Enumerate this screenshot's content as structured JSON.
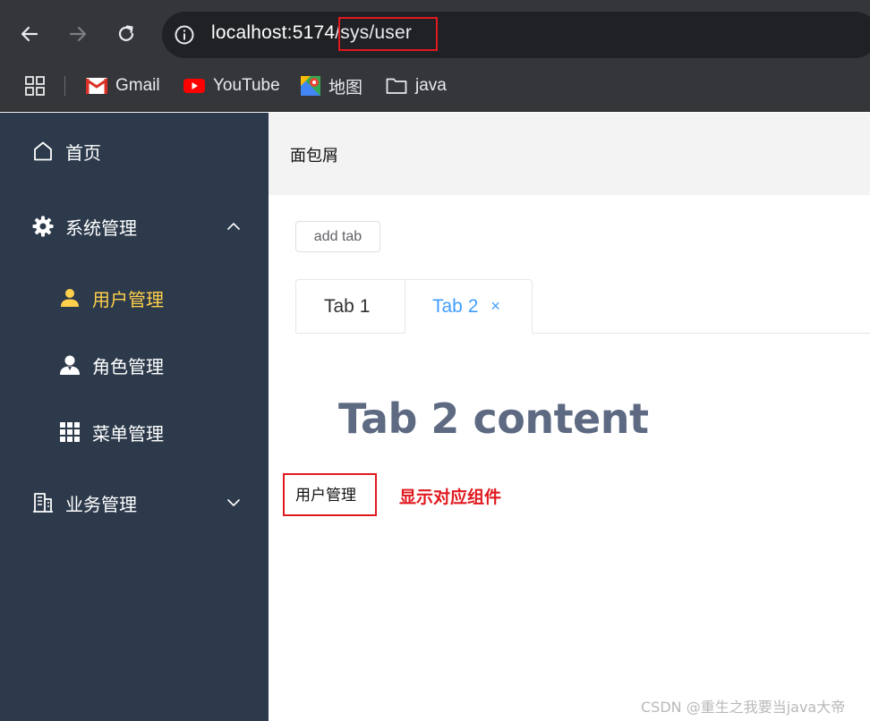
{
  "browser": {
    "url_host": "localhost:5174",
    "url_path": "/sys/user",
    "bookmarks": [
      "Gmail",
      "YouTube",
      "地图",
      "java"
    ]
  },
  "sidebar": {
    "items": [
      {
        "label": "首页",
        "icon": "home-icon"
      },
      {
        "label": "系统管理",
        "icon": "gear-icon",
        "expanded": true
      },
      {
        "label": "用户管理",
        "icon": "user-icon",
        "active": true
      },
      {
        "label": "角色管理",
        "icon": "person-icon"
      },
      {
        "label": "菜单管理",
        "icon": "grid-icon"
      },
      {
        "label": "业务管理",
        "icon": "building-icon",
        "expanded": false
      }
    ],
    "background": "#2d3a4b",
    "active_color": "#ffd04b"
  },
  "header": {
    "breadcrumb": "面包屑"
  },
  "main": {
    "add_tab_label": "add tab",
    "tabs": [
      {
        "label": "Tab 1",
        "active": false
      },
      {
        "label": "Tab 2",
        "active": true,
        "closable": true
      }
    ],
    "close_glyph": "×",
    "tab_content": "Tab 2 content",
    "component_text": "用户管理",
    "annotation": "显示对应组件"
  },
  "watermark": "CSDN @重生之我要当java大帝",
  "colors": {
    "accent": "#409eff",
    "highlight_red": "#e0191f"
  }
}
